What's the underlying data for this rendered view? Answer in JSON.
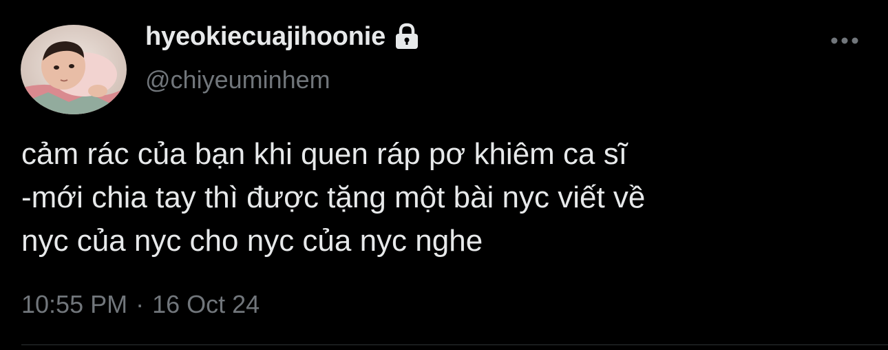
{
  "user": {
    "display_name": "hyeokiecuajihoonie",
    "handle": "@chiyeuminhem",
    "protected_icon": "lock-icon",
    "avatar_icon": "avatar"
  },
  "tweet": {
    "text": "cảm rác của bạn khi quen ráp pơ khiêm ca sĩ\n-mới chia tay thì được tặng một bài nyc viết về\nnyc của nyc cho nyc của nyc nghe",
    "time": "10:55 PM",
    "separator": "·",
    "date": "16 Oct 24"
  },
  "actions": {
    "more_icon": "more-horizontal-icon"
  },
  "colors": {
    "background": "#000000",
    "primary_text": "#e7e9ea",
    "secondary_text": "#71767b",
    "divider": "#2f3336"
  }
}
